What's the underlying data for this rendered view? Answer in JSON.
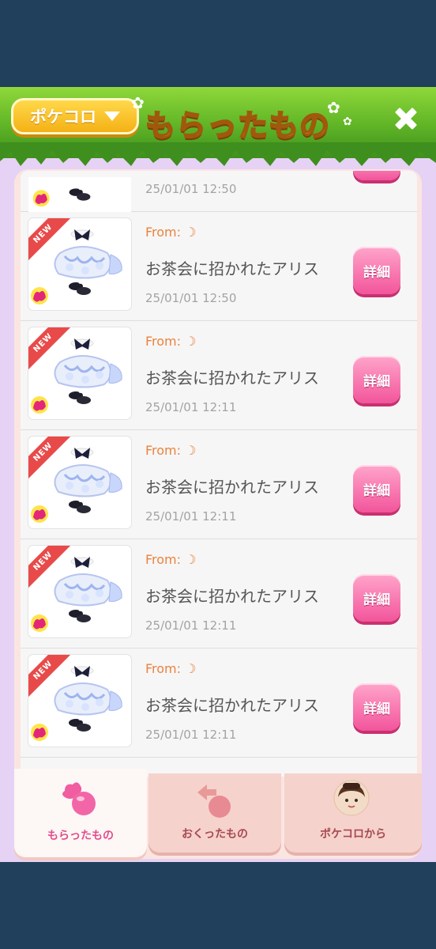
{
  "header": {
    "account_label": "ポケコロ",
    "title": "もらったもの"
  },
  "items": [
    {
      "from": "",
      "name": "",
      "date": "25/01/01 12:50",
      "detail_label": ""
    },
    {
      "from": "From: ☽",
      "name": "お茶会に招かれたアリス",
      "date": "25/01/01 12:50",
      "detail_label": "詳細",
      "badge": "NEW"
    },
    {
      "from": "From: ☽",
      "name": "お茶会に招かれたアリス",
      "date": "25/01/01 12:11",
      "detail_label": "詳細",
      "badge": "NEW"
    },
    {
      "from": "From: ☽",
      "name": "お茶会に招かれたアリス",
      "date": "25/01/01 12:11",
      "detail_label": "詳細",
      "badge": "NEW"
    },
    {
      "from": "From: ☽",
      "name": "お茶会に招かれたアリス",
      "date": "25/01/01 12:11",
      "detail_label": "詳細",
      "badge": "NEW"
    },
    {
      "from": "From: ☽",
      "name": "お茶会に招かれたアリス",
      "date": "25/01/01 12:11",
      "detail_label": "詳細",
      "badge": "NEW"
    }
  ],
  "tabs": [
    {
      "label": "もらったもの",
      "active": true
    },
    {
      "label": "おくったもの",
      "active": false
    },
    {
      "label": "ポケコロから",
      "active": false
    }
  ],
  "colors": {
    "accent_pink": "#f2559b",
    "from_orange": "#e8833f",
    "header_green": "#5fb426",
    "background_lavender": "#e6d2f4",
    "frame_navy": "#21405b"
  }
}
